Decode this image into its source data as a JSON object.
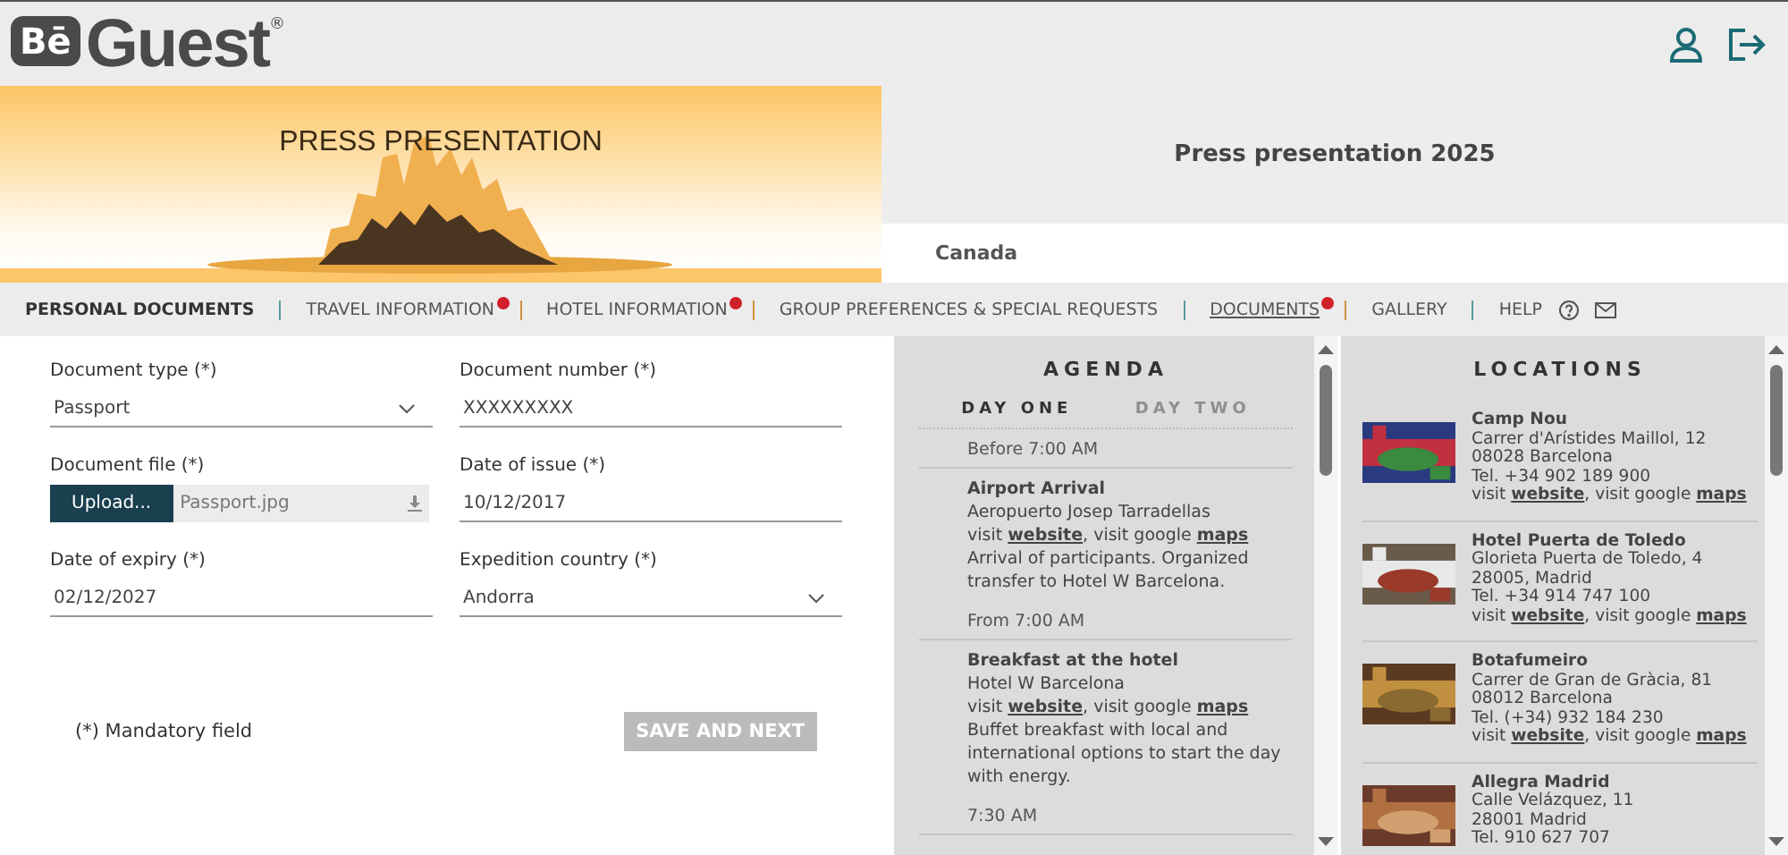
{
  "header": {
    "logo": {
      "mark": "Bē",
      "name": "Guest",
      "registered": "®"
    }
  },
  "banner": {
    "image": {
      "kind": "picture",
      "title": "PRESS PRESENTATION"
    },
    "event_title": "Press presentation 2025",
    "country": "Canada"
  },
  "nav": [
    {
      "label": "PERSONAL DOCUMENTS",
      "selected": true,
      "alert": false
    },
    {
      "label": "TRAVEL INFORMATION",
      "selected": false,
      "alert": true
    },
    {
      "label": "HOTEL INFORMATION",
      "selected": false,
      "alert": true
    },
    {
      "label": "GROUP PREFERENCES & SPECIAL REQUESTS",
      "selected": false,
      "alert": false
    },
    {
      "label": "DOCUMENTS",
      "selected": false,
      "alert": true,
      "hovered": true
    },
    {
      "label": "GALLERY",
      "selected": false,
      "alert": false
    },
    {
      "label": "HELP",
      "selected": false,
      "alert": false,
      "kind": "help"
    }
  ],
  "form": {
    "fields": [
      {
        "kind": "select",
        "label": "Document type (*)",
        "value": "Passport"
      },
      {
        "kind": "text",
        "label": "Document number (*)",
        "value": "XXXXXXXXX"
      },
      {
        "kind": "file",
        "label": "Document file (*)",
        "button": "Upload...",
        "value": "Passport.jpg"
      },
      {
        "kind": "text",
        "label": "Date of issue (*)",
        "value": "10/12/2017"
      },
      {
        "kind": "text",
        "label": "Date of expiry (*)",
        "value": "02/12/2027"
      },
      {
        "kind": "select",
        "label": "Expedition country (*)",
        "value": "Andorra"
      }
    ],
    "note": "(*) Mandatory field",
    "submit": {
      "label": "SAVE AND NEXT",
      "disabled": true
    }
  },
  "agenda": {
    "title": "AGENDA",
    "days": [
      {
        "label": "DAY ONE",
        "selected": true
      },
      {
        "label": "DAY TWO",
        "selected": false
      }
    ],
    "entries": [
      {
        "time": "Before 7:00 AM",
        "title": "Airport Arrival",
        "place": "Aeropuerto Josep Tarradellas",
        "links": [
          {
            "text": "visit "
          },
          {
            "link": "website"
          },
          {
            "text": ", visit google "
          },
          {
            "link": "maps"
          }
        ],
        "description": "Arrival of participants. Organized transfer to Hotel W Barcelona."
      },
      {
        "time": "From 7:00 AM",
        "title": "Breakfast at the hotel",
        "place": "Hotel W Barcelona",
        "links": [
          {
            "text": "visit "
          },
          {
            "link": "website"
          },
          {
            "text": ", visit google "
          },
          {
            "link": "maps"
          }
        ],
        "description": "Buffet breakfast with local and international options to start the day with energy."
      },
      {
        "time": "7:30 AM"
      }
    ]
  },
  "locations": {
    "title": "LOCATIONS",
    "items": [
      {
        "name": "Camp Nou",
        "address": "Carrer d'Arístides Maillol, 12",
        "city": "08028 Barcelona",
        "phone": "Tel. +34 902 189 900",
        "links": [
          {
            "text": "visit "
          },
          {
            "link": "website"
          },
          {
            "text": ", visit google "
          },
          {
            "link": "maps"
          }
        ]
      },
      {
        "name": "Hotel Puerta de Toledo",
        "address": "Glorieta Puerta de Toledo, 4",
        "city": "28005, Madrid",
        "phone": "Tel. +34 914 747 100",
        "links": [
          {
            "text": "visit "
          },
          {
            "link": "website"
          },
          {
            "text": ", visit google "
          },
          {
            "link": "maps"
          }
        ]
      },
      {
        "name": "Botafumeiro",
        "address": "Carrer de Gran de Gràcia, 81",
        "city": "08012 Barcelona",
        "phone": "Tel. (+34) 932 184 230",
        "links": [
          {
            "text": "visit "
          },
          {
            "link": "website"
          },
          {
            "text": ", visit google "
          },
          {
            "link": "maps"
          }
        ]
      },
      {
        "name": "Allegra Madrid",
        "address": "Calle Velázquez, 11",
        "city": "28001 Madrid",
        "phone": "Tel. 910 627 707"
      }
    ]
  }
}
